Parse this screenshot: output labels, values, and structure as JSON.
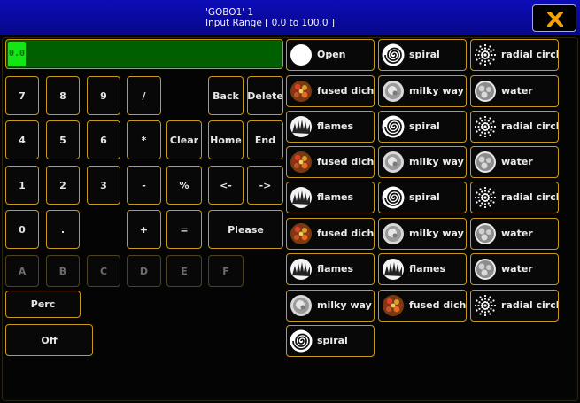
{
  "titlebar": {
    "title": "'GOBO1' 1",
    "subtitle": "Input Range [ 0.0 to 100.0 ]"
  },
  "close_icon": "close-x-icon",
  "display": {
    "value": "0.0"
  },
  "keypad": [
    {
      "id": "7",
      "label": "7"
    },
    {
      "id": "8",
      "label": "8"
    },
    {
      "id": "9",
      "label": "9"
    },
    {
      "id": "slash",
      "label": "/"
    },
    {
      "id": "back",
      "label": "Back"
    },
    {
      "id": "delete",
      "label": "Delete"
    },
    {
      "id": "4",
      "label": "4"
    },
    {
      "id": "5",
      "label": "5"
    },
    {
      "id": "6",
      "label": "6"
    },
    {
      "id": "star",
      "label": "*"
    },
    {
      "id": "clear",
      "label": "Clear"
    },
    {
      "id": "home",
      "label": "Home"
    },
    {
      "id": "end",
      "label": "End"
    },
    {
      "id": "1",
      "label": "1"
    },
    {
      "id": "2",
      "label": "2"
    },
    {
      "id": "3",
      "label": "3"
    },
    {
      "id": "minus",
      "label": "-"
    },
    {
      "id": "percent",
      "label": "%"
    },
    {
      "id": "left",
      "label": "<-"
    },
    {
      "id": "right",
      "label": "->"
    },
    {
      "id": "0",
      "label": "0"
    },
    {
      "id": "dot",
      "label": "."
    },
    {
      "id": "plus",
      "label": "+"
    },
    {
      "id": "equals",
      "label": "="
    },
    {
      "id": "please",
      "label": "Please"
    },
    {
      "id": "A",
      "label": "A"
    },
    {
      "id": "B",
      "label": "B"
    },
    {
      "id": "C",
      "label": "C"
    },
    {
      "id": "D",
      "label": "D"
    },
    {
      "id": "E",
      "label": "E"
    },
    {
      "id": "F",
      "label": "F"
    },
    {
      "id": "perc",
      "label": "Perc"
    },
    {
      "id": "off",
      "label": "Off"
    }
  ],
  "gobos": [
    {
      "label": "Open",
      "icon": "open-gobo-icon"
    },
    {
      "label": "spiral",
      "icon": "spiral-gobo-icon"
    },
    {
      "label": "radial circle",
      "icon": "radial-circle-gobo-icon"
    },
    {
      "label": "fused dichro",
      "icon": "fused-dichro-gobo-icon"
    },
    {
      "label": "milky way",
      "icon": "milky-way-gobo-icon"
    },
    {
      "label": "water",
      "icon": "water-gobo-icon"
    },
    {
      "label": "flames",
      "icon": "flames-gobo-icon"
    },
    {
      "label": "spiral",
      "icon": "spiral-gobo-icon"
    },
    {
      "label": "radial circle",
      "icon": "radial-circle-gobo-icon"
    },
    {
      "label": "fused dichro",
      "icon": "fused-dichro-gobo-icon"
    },
    {
      "label": "milky way",
      "icon": "milky-way-gobo-icon"
    },
    {
      "label": "water",
      "icon": "water-gobo-icon"
    },
    {
      "label": "flames",
      "icon": "flames-gobo-icon"
    },
    {
      "label": "spiral",
      "icon": "spiral-gobo-icon"
    },
    {
      "label": "radial circle",
      "icon": "radial-circle-gobo-icon"
    },
    {
      "label": "fused dichro",
      "icon": "fused-dichro-gobo-icon"
    },
    {
      "label": "milky way",
      "icon": "milky-way-gobo-icon"
    },
    {
      "label": "water",
      "icon": "water-gobo-icon"
    },
    {
      "label": "flames",
      "icon": "flames-gobo-icon"
    },
    {
      "label": "flames",
      "icon": "flames-gobo-icon"
    },
    {
      "label": "water",
      "icon": "water-gobo-icon"
    },
    {
      "label": "milky way",
      "icon": "milky-way-gobo-icon"
    },
    {
      "label": "fused dichro",
      "icon": "fused-dichro-gobo-icon"
    },
    {
      "label": "radial circle",
      "icon": "radial-circle-gobo-icon"
    },
    {
      "label": "spiral",
      "icon": "spiral-gobo-icon"
    }
  ]
}
